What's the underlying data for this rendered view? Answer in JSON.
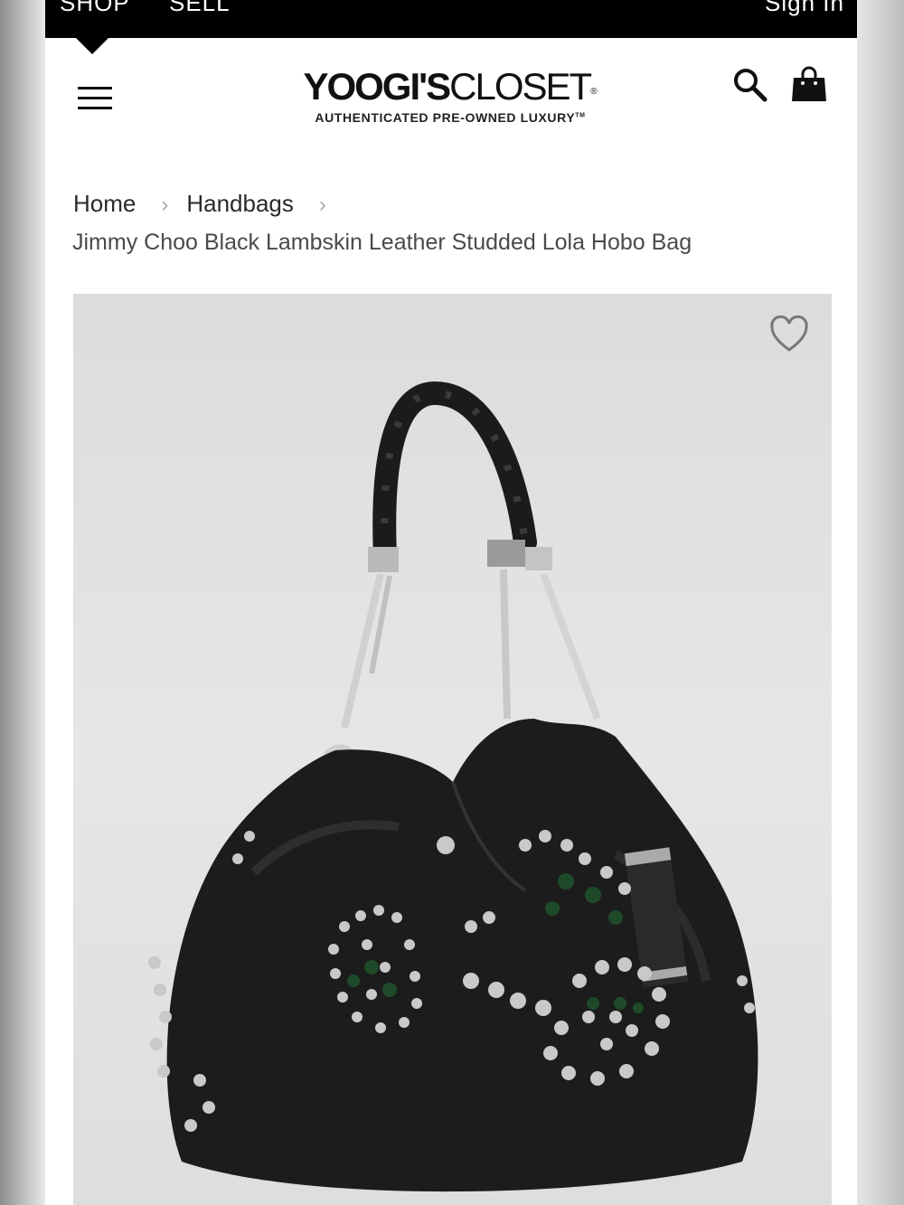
{
  "topbar": {
    "shop_label": "SHOP",
    "sell_label": "SELL",
    "signin_label": "Sign In"
  },
  "header": {
    "logo_bold": "YOOGI'S",
    "logo_light": "CLOSET",
    "logo_mark": "®",
    "tagline": "AUTHENTICATED PRE-OWNED LUXURY",
    "tagline_mark": "TM",
    "menu_icon": "hamburger-menu-icon",
    "search_icon": "search-icon",
    "cart_icon": "shopping-bag-icon"
  },
  "breadcrumb": {
    "items": [
      {
        "label": "Home"
      },
      {
        "label": "Handbags"
      }
    ],
    "separator": "›"
  },
  "product": {
    "title": "Jimmy Choo Black Lambskin Leather Studded Lola Hobo Bag",
    "wishlist_icon": "heart-outline-icon"
  },
  "colors": {
    "topbar_bg": "#000000",
    "page_bg": "#ffffff",
    "photo_bg": "#e2e2e2",
    "bag": "#1a1a1a"
  }
}
